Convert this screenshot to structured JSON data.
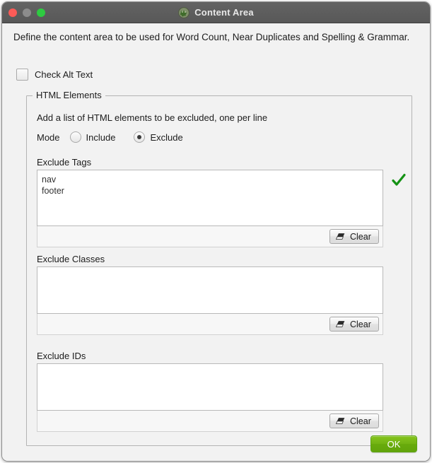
{
  "window": {
    "title": "Content Area",
    "app_icon": "frog-icon",
    "controls": {
      "close": "close-button",
      "minimize": "minimize-button",
      "zoom": "zoom-button"
    },
    "colors": {
      "close": "#fc5b57",
      "minimize": "#8c8c8c",
      "zoom": "#2ecb41",
      "titlebar": "#5b5b5b",
      "accent_ok": "#72b313",
      "check": "#1a9d1a"
    }
  },
  "content": {
    "intro": "Define the content area to be used for Word Count, Near Duplicates and Spelling & Grammar.",
    "check_alt_text": {
      "label": "Check Alt Text",
      "checked": false
    },
    "group": {
      "title": "HTML Elements",
      "hint": "Add a list of HTML elements to be excluded, one per line",
      "mode": {
        "label": "Mode",
        "options": [
          {
            "label": "Include",
            "selected": false
          },
          {
            "label": "Exclude",
            "selected": true
          }
        ],
        "selected": "Exclude"
      },
      "fields": [
        {
          "label": "Exclude Tags",
          "value": "nav\nfooter",
          "placeholder": "",
          "clear_label": "Clear",
          "clear_icon": "eraser-icon",
          "status_icon": "check-mark-icon",
          "status_visible": true
        },
        {
          "label": "Exclude Classes",
          "value": "",
          "placeholder": "",
          "clear_label": "Clear",
          "clear_icon": "eraser-icon",
          "status_icon": "check-mark-icon",
          "status_visible": false
        },
        {
          "label": "Exclude IDs",
          "value": "",
          "placeholder": "",
          "clear_label": "Clear",
          "clear_icon": "eraser-icon",
          "status_icon": "check-mark-icon",
          "status_visible": false
        }
      ]
    }
  },
  "footer": {
    "ok_label": "OK"
  }
}
